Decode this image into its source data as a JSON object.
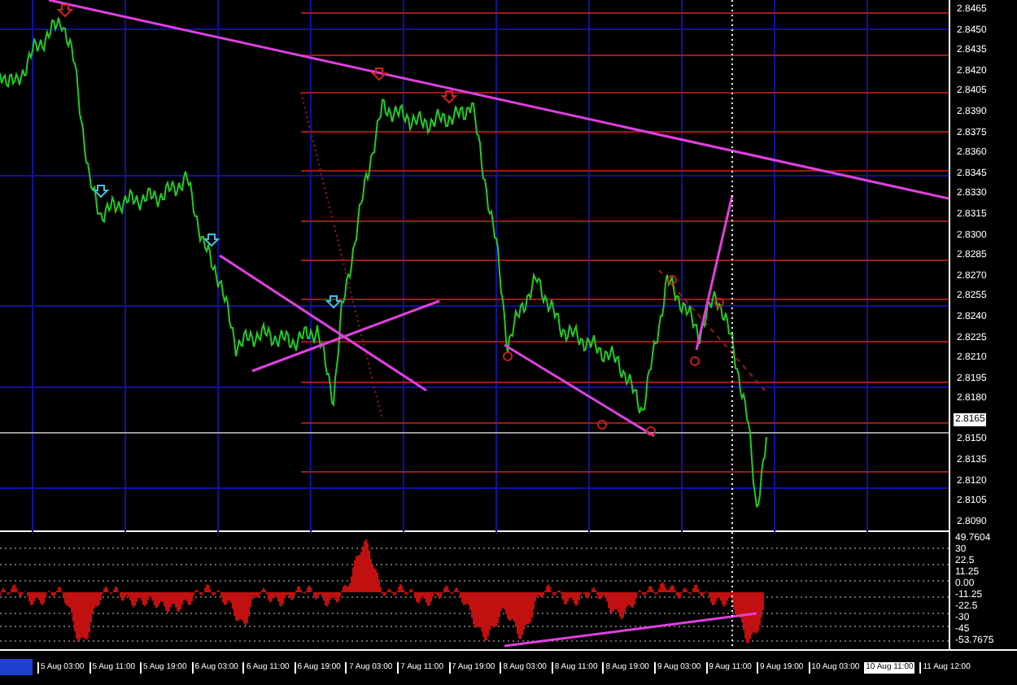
{
  "price_axis": {
    "labels": [
      {
        "kind": "tick",
        "text": "2.8465"
      },
      {
        "kind": "tick",
        "text": "2.8450"
      },
      {
        "kind": "tick",
        "text": "2.8435"
      },
      {
        "kind": "tick",
        "text": "2.8420"
      },
      {
        "kind": "tick",
        "text": "2.8405"
      },
      {
        "kind": "tick",
        "text": "2.8390"
      },
      {
        "kind": "tick",
        "text": "2.8375"
      },
      {
        "kind": "tick",
        "text": "2.8360"
      },
      {
        "kind": "tick",
        "text": "2.8345"
      },
      {
        "kind": "tick",
        "text": "2.8330"
      },
      {
        "kind": "tick",
        "text": "2.8315"
      },
      {
        "kind": "tick",
        "text": "2.8300"
      },
      {
        "kind": "tick",
        "text": "2.8285"
      },
      {
        "kind": "tick",
        "text": "2.8270"
      },
      {
        "kind": "tick",
        "text": "2.8255"
      },
      {
        "kind": "tick",
        "text": "2.8240"
      },
      {
        "kind": "tick",
        "text": "2.8225"
      },
      {
        "kind": "tick",
        "text": "2.8210"
      },
      {
        "kind": "tick",
        "text": "2.8195"
      },
      {
        "kind": "tick",
        "text": "2.8180"
      },
      {
        "kind": "current",
        "text": "2.8165"
      },
      {
        "kind": "tick",
        "text": "2.8150"
      },
      {
        "kind": "tick",
        "text": "2.8135"
      },
      {
        "kind": "tick",
        "text": "2.8120"
      },
      {
        "kind": "tick",
        "text": "2.8105"
      },
      {
        "kind": "tick",
        "text": "2.8090"
      }
    ]
  },
  "indicator_axis": {
    "labels": [
      "49.7604",
      "30",
      "22.5",
      "11.25",
      "0.00",
      "-11.25",
      "-22.5",
      "-30",
      "-45",
      "-53.7675"
    ]
  },
  "time_axis": {
    "labels": [
      {
        "kind": "tick",
        "text": "5 Aug 03:00"
      },
      {
        "kind": "tick",
        "text": "5 Aug 11:00"
      },
      {
        "kind": "tick",
        "text": "5 Aug 19:00"
      },
      {
        "kind": "tick",
        "text": "6 Aug 03:00"
      },
      {
        "kind": "tick",
        "text": "6 Aug 11:00"
      },
      {
        "kind": "tick",
        "text": "6 Aug 19:00"
      },
      {
        "kind": "tick",
        "text": "7 Aug 03:00"
      },
      {
        "kind": "tick",
        "text": "7 Aug 11:00"
      },
      {
        "kind": "tick",
        "text": "7 Aug 19:00"
      },
      {
        "kind": "tick",
        "text": "8 Aug 03:00"
      },
      {
        "kind": "tick",
        "text": "8 Aug 11:00"
      },
      {
        "kind": "tick",
        "text": "8 Aug 19:00"
      },
      {
        "kind": "tick",
        "text": "9 Aug 03:00"
      },
      {
        "kind": "tick",
        "text": "9 Aug 11:00"
      },
      {
        "kind": "tick",
        "text": "9 Aug 19:00"
      },
      {
        "kind": "tick",
        "text": "10 Aug 03:00"
      },
      {
        "kind": "cursor",
        "text": "10 Aug 11:00"
      },
      {
        "kind": "tick",
        "text": "11 Aug 12:00"
      }
    ]
  }
}
